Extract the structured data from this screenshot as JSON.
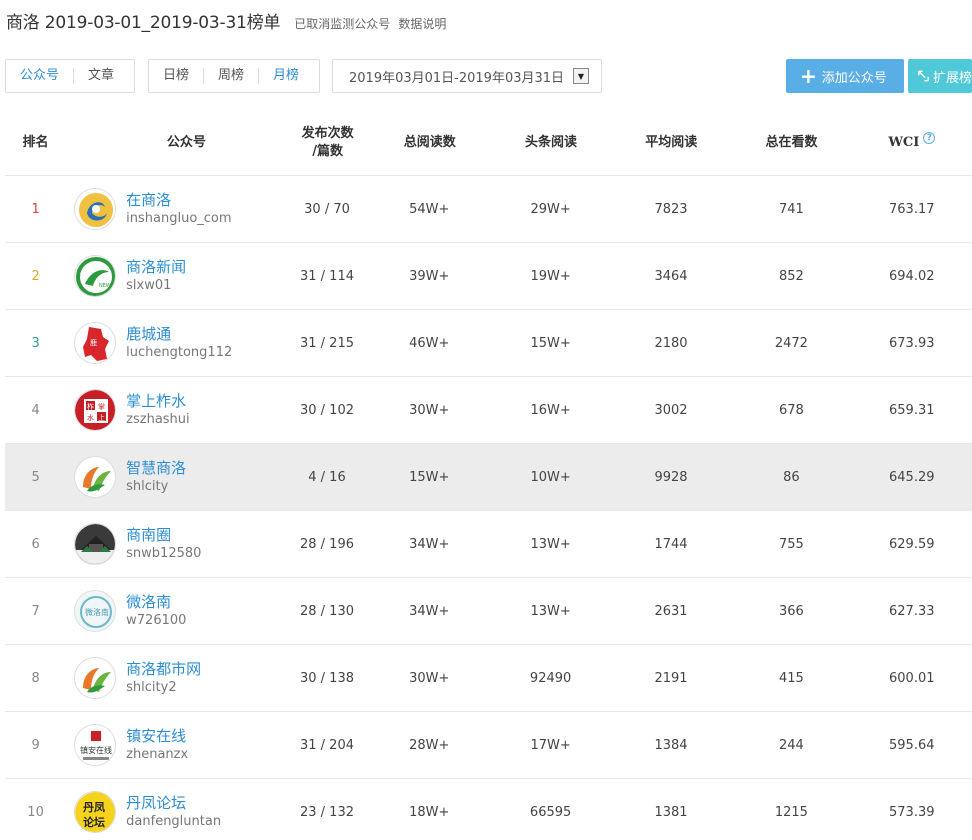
{
  "header": {
    "title": "商洛 2019-03-01_2019-03-31榜单",
    "links": [
      "已取消监测公众号",
      "数据说明"
    ]
  },
  "toolbar": {
    "type_tabs": [
      {
        "label": "公众号",
        "active": true
      },
      {
        "label": "文章",
        "active": false
      }
    ],
    "rank_tabs": [
      {
        "label": "日榜",
        "active": false
      },
      {
        "label": "周榜",
        "active": false
      },
      {
        "label": "月榜",
        "active": true
      }
    ],
    "date_range": "2019年03月01日-2019年03月31日",
    "add_button": "添加公众号",
    "ext_button": "扩展榜"
  },
  "table": {
    "headers": {
      "rank": "排名",
      "account": "公众号",
      "publish_1": "发布次数",
      "publish_2": "/篇数",
      "total_reads": "总阅读数",
      "headline_reads": "头条阅读",
      "avg_reads": "平均阅读",
      "total_looking": "总在看数",
      "wci": "WCI",
      "wci_help": "?"
    },
    "rows": [
      {
        "rank": "1",
        "name": "在商洛",
        "id": "inshangluo_com",
        "publish": "30 / 70",
        "total_reads": "54W+",
        "headline_reads": "29W+",
        "avg_reads": "7823",
        "looking": "741",
        "wci": "763.17"
      },
      {
        "rank": "2",
        "name": "商洛新闻",
        "id": "slxw01",
        "publish": "31 / 114",
        "total_reads": "39W+",
        "headline_reads": "19W+",
        "avg_reads": "3464",
        "looking": "852",
        "wci": "694.02"
      },
      {
        "rank": "3",
        "name": "鹿城通",
        "id": "luchengtong112",
        "publish": "31 / 215",
        "total_reads": "46W+",
        "headline_reads": "15W+",
        "avg_reads": "2180",
        "looking": "2472",
        "wci": "673.93"
      },
      {
        "rank": "4",
        "name": "掌上柞水",
        "id": "zszhashui",
        "publish": "30 / 102",
        "total_reads": "30W+",
        "headline_reads": "16W+",
        "avg_reads": "3002",
        "looking": "678",
        "wci": "659.31"
      },
      {
        "rank": "5",
        "name": "智慧商洛",
        "id": "shlcity",
        "publish": "4 / 16",
        "total_reads": "15W+",
        "headline_reads": "10W+",
        "avg_reads": "9928",
        "looking": "86",
        "wci": "645.29"
      },
      {
        "rank": "6",
        "name": "商南圈",
        "id": "snwb12580",
        "publish": "28 / 196",
        "total_reads": "34W+",
        "headline_reads": "13W+",
        "avg_reads": "1744",
        "looking": "755",
        "wci": "629.59"
      },
      {
        "rank": "7",
        "name": "微洛南",
        "id": "w726100",
        "publish": "28 / 130",
        "total_reads": "34W+",
        "headline_reads": "13W+",
        "avg_reads": "2631",
        "looking": "366",
        "wci": "627.33"
      },
      {
        "rank": "8",
        "name": "商洛都市网",
        "id": "shlcity2",
        "publish": "30 / 138",
        "total_reads": "30W+",
        "headline_reads": "92490",
        "avg_reads": "2191",
        "looking": "415",
        "wci": "600.01"
      },
      {
        "rank": "9",
        "name": "镇安在线",
        "id": "zhenanzx",
        "publish": "31 / 204",
        "total_reads": "28W+",
        "headline_reads": "17W+",
        "avg_reads": "1384",
        "looking": "244",
        "wci": "595.64"
      },
      {
        "rank": "10",
        "name": "丹凤论坛",
        "id": "danfenglunta​n",
        "publish": "23 / 132",
        "total_reads": "18W+",
        "headline_reads": "66595",
        "avg_reads": "1381",
        "looking": "1215",
        "wci": "573.39"
      }
    ]
  },
  "colors": {
    "accent": "#2d8ed6",
    "rank1": "#e0434b",
    "rank2": "#e6a72b",
    "rank3": "#2aa38b",
    "rank_other": "#888888",
    "add_button": "#5aaee6",
    "ext_button": "#4fc8d8",
    "hover_row": "#ececec"
  },
  "icons": {
    "avatars": [
      "in-shangluo-logo",
      "shangluo-news-logo",
      "lucheng-logo",
      "zhashui-logo",
      "zhihui-logo",
      "shangnan-logo",
      "luonan-logo",
      "dushi-logo",
      "zhenan-logo",
      "danfeng-logo"
    ]
  }
}
